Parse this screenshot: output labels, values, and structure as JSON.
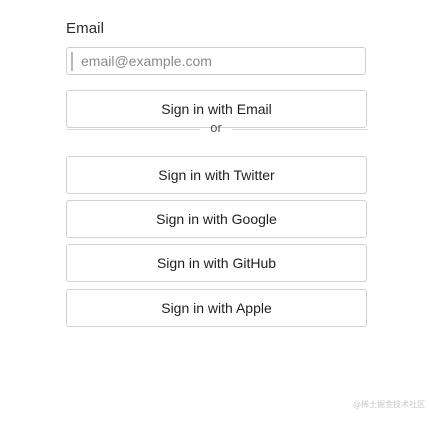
{
  "form": {
    "email_label": "Email",
    "email_placeholder": "email@example.com",
    "email_value": "",
    "sign_in_email": "Sign in with Email",
    "divider_text": "or",
    "providers": [
      {
        "label": "Sign in with Twitter"
      },
      {
        "label": "Sign in with Google"
      },
      {
        "label": "Sign in with GitHub"
      },
      {
        "label": "Sign in with Apple"
      }
    ]
  },
  "watermark": "@稀土掘金技术社区"
}
